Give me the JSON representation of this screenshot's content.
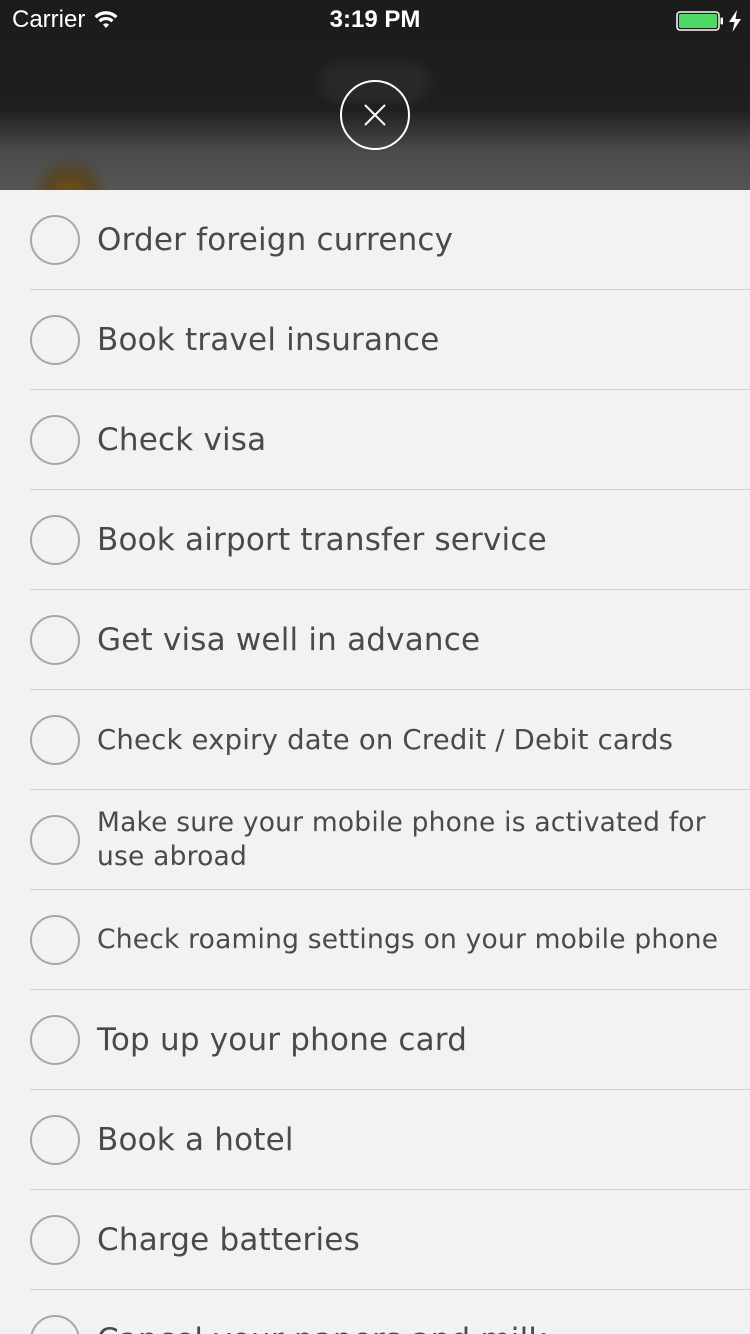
{
  "status_bar": {
    "carrier": "Carrier",
    "time": "3:19 PM"
  },
  "colors": {
    "battery_fill": "#4cd964",
    "list_background": "#f2f2f2",
    "text": "#4a4a4a",
    "radio_border": "#a7a7a7"
  },
  "header": {
    "close_icon": "close-icon"
  },
  "checklist": {
    "items": [
      {
        "label": "Order foreign currency"
      },
      {
        "label": "Book travel insurance"
      },
      {
        "label": "Check visa"
      },
      {
        "label": "Book airport transfer service"
      },
      {
        "label": "Get visa well in advance"
      },
      {
        "label": "Check expiry date on Credit / Debit cards"
      },
      {
        "label": "Make sure your mobile phone is activated for use abroad"
      },
      {
        "label": "Check roaming settings on your mobile phone"
      },
      {
        "label": "Top up your phone card"
      },
      {
        "label": "Book a hotel"
      },
      {
        "label": "Charge batteries"
      },
      {
        "label": "Cancel your papers and milk"
      }
    ]
  }
}
